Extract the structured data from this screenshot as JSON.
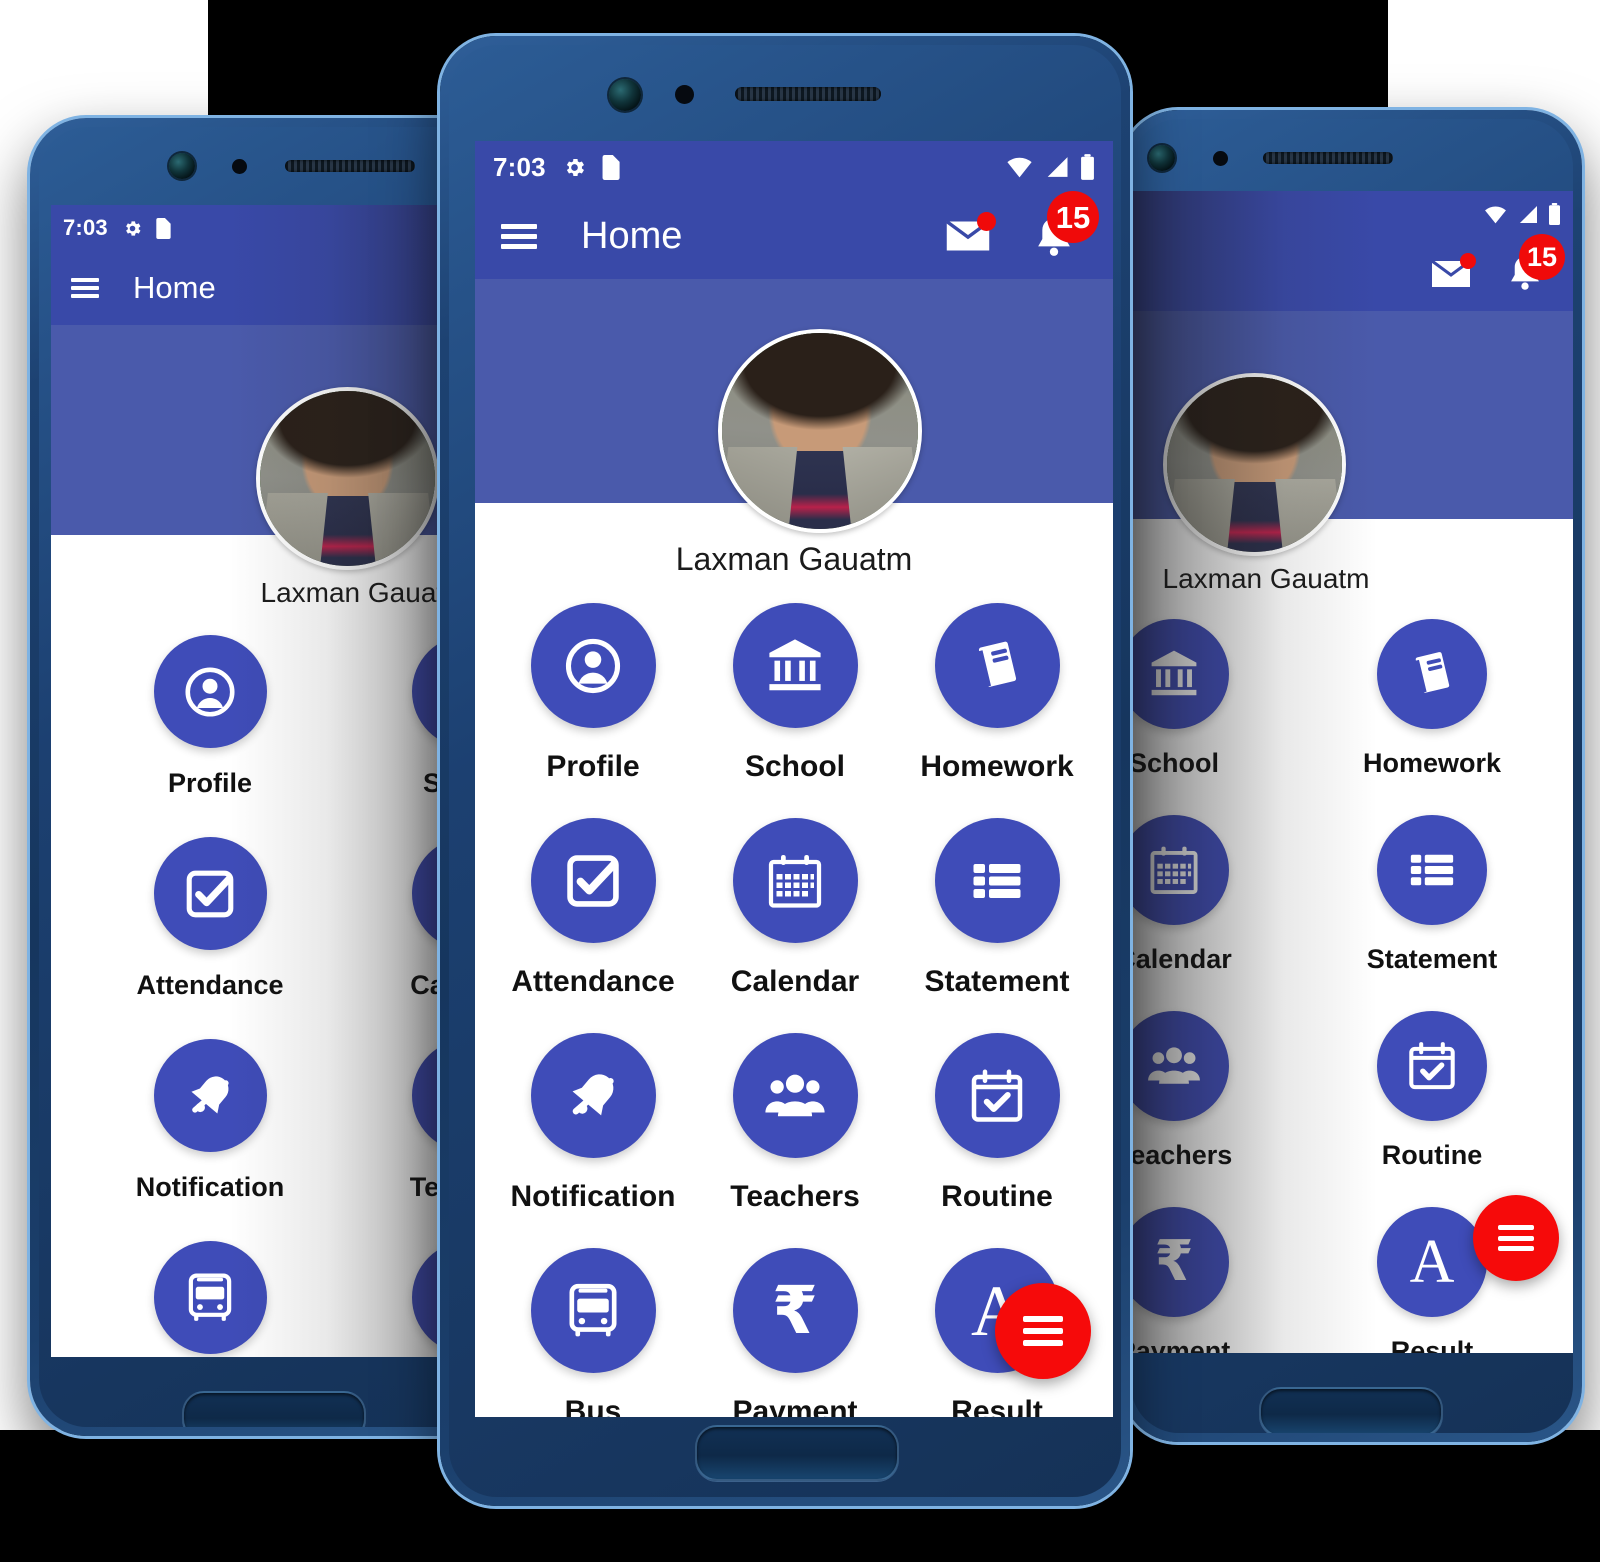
{
  "app": {
    "title": "Home",
    "status_bar": {
      "time": "7:03",
      "icons": [
        "gear-icon",
        "sim-card-icon",
        "wifi-icon",
        "signal-icon",
        "battery-icon"
      ]
    },
    "appbar_actions": {
      "menu": "menu-icon",
      "mail": "mail-icon",
      "mail_has_unread": true,
      "bell": "bell-icon",
      "bell_badge_count": "15"
    },
    "profile": {
      "name": "Laxman Gauatm",
      "avatar": "user-photo"
    },
    "fab": {
      "icon": "menu-lines-icon",
      "color": "#f60a0a"
    },
    "colors": {
      "appbar": "#3949a8",
      "header_band": "#4a5aab",
      "tile": "#3f4cb8",
      "accent_red": "#f60a0a",
      "content_bg": "#ffffff",
      "label_text": "#111111"
    },
    "grid_items": [
      {
        "label": "Profile",
        "icon": "user-circle-icon"
      },
      {
        "label": "School",
        "icon": "bank-building-icon"
      },
      {
        "label": "Homework",
        "icon": "book-icon"
      },
      {
        "label": "Attendance",
        "icon": "checkbox-check-icon"
      },
      {
        "label": "Calendar",
        "icon": "calendar-icon"
      },
      {
        "label": "Statement",
        "icon": "list-icon"
      },
      {
        "label": "Notification",
        "icon": "bell-off-icon"
      },
      {
        "label": "Teachers",
        "icon": "people-group-icon"
      },
      {
        "label": "Routine",
        "icon": "calendar-check-icon"
      },
      {
        "label": "Bus",
        "icon": "bus-icon"
      },
      {
        "label": "Payment",
        "icon": "rupee-icon"
      },
      {
        "label": "Result",
        "icon": "letter-a-icon"
      }
    ]
  },
  "phones": {
    "left": {
      "visible_columns": [
        "Profile",
        "School"
      ],
      "label": "left-phone"
    },
    "center": {
      "visible_columns": [
        "all"
      ],
      "label": "center-phone"
    },
    "right": {
      "visible_columns": [
        "School",
        "Homework"
      ],
      "label": "right-phone"
    }
  }
}
